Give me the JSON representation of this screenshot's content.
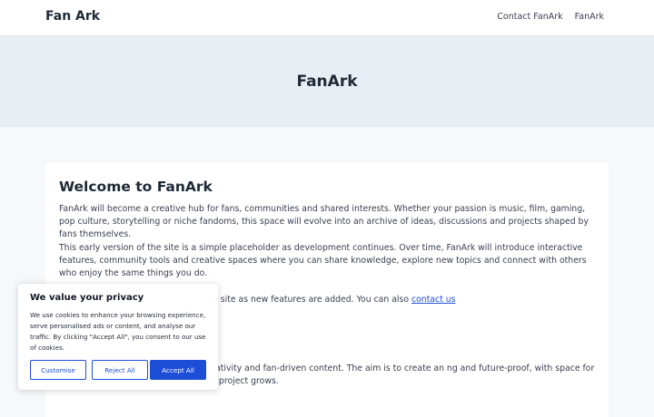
{
  "header": {
    "brand": "Fan Ark",
    "nav": [
      "Contact FanArk",
      "FanArk"
    ]
  },
  "hero": {
    "title": "FanArk"
  },
  "main": {
    "heading": "Welcome to FanArk",
    "p1": "FanArk will become a creative hub for fans, communities and shared interests. Whether your passion is music, film, gaming, pop culture, storytelling or niche fandoms, this space will evolve into an archive of ideas, discussions and projects shaped by fans themselves.",
    "p2": "This early version of the site is a simple placeholder as development continues. Over time, FanArk will introduce interactive features, community tools and creative spaces where you can share knowledge, explore new topics and connect with others who enjoy the same things you do.",
    "p3_text": "r get involved later, simply revisit the site as new features are added. You can also ",
    "p3_link": "contact us",
    "p4": "orm with a focus on accessibility, creativity and fan-driven content. The aim is to create an ng and future-proof, with space for communities to form naturally as the project grows."
  },
  "cookie": {
    "title": "We value your privacy",
    "body": "We use cookies to enhance your browsing experience, serve personalised ads or content, and analyse our traffic. By clicking \"Accept All\", you consent to our use of cookies.",
    "customise": "Customise",
    "reject": "Reject All",
    "accept": "Accept All"
  },
  "colors": {
    "accent": "#1d4ed8",
    "hero_bg": "#e9eef4",
    "page_bg": "#f5f9fc"
  }
}
